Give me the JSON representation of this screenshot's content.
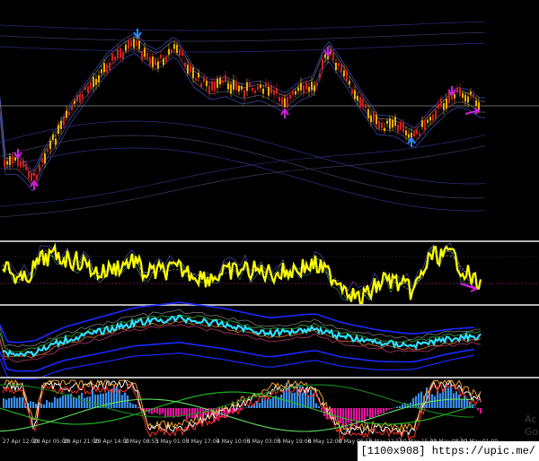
{
  "image_badge": "[1100x908] https://upic.me/",
  "watermark": {
    "line1": "Ac",
    "line2": "Go"
  },
  "time_axis": [
    "27 Apr 12:00",
    "28 Apr 05:00",
    "28 Apr 21:00",
    "29 Apr 14:00",
    "2 May 08:55",
    "3 May 01:00",
    "3 May 17:00",
    "4 May 10:00",
    "5 May 03:00",
    "5 May 19:00",
    "6 May 12:00",
    "9 May 06:55",
    "9 May 22:55",
    "10 May 15:00",
    "11 May 08:00",
    "12 May 01:00"
  ],
  "colors": {
    "background": "#000000",
    "separator": "#b4b4b4",
    "bull": "#f0b000",
    "bear": "#d02020",
    "oscillator": "#ffff00",
    "ma_cyan": "#30e0ff",
    "histogram_up": "#3a8ee6",
    "histogram_down": "#e0109a",
    "arrow_blue": "#2a8cff",
    "arrow_magenta": "#d020e0"
  },
  "panels": [
    {
      "name": "price",
      "type": "candlestick",
      "signals": [
        "sell-arrow",
        "buy-arrow"
      ]
    },
    {
      "name": "oscillator",
      "type": "line"
    },
    {
      "name": "moving-averages",
      "type": "line"
    },
    {
      "name": "histogram",
      "type": "bar"
    }
  ]
}
